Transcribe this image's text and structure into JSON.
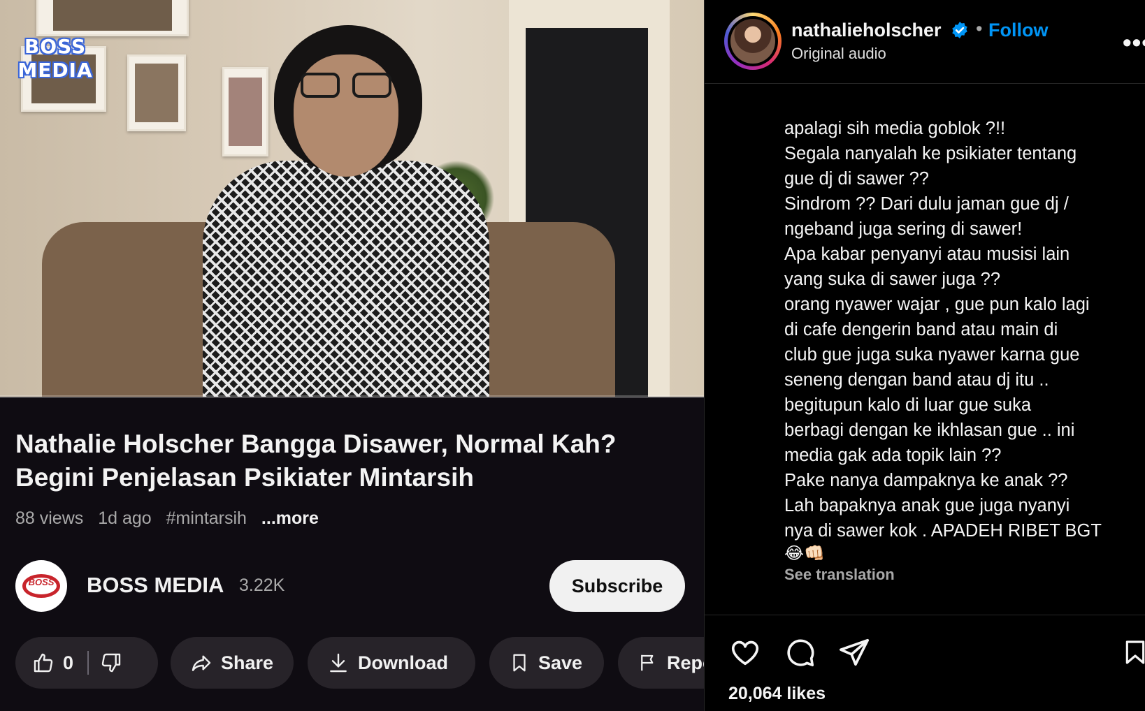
{
  "video": {
    "overlay_logo": [
      "BOSS",
      "MEDIA"
    ],
    "title_line1": "Nathalie Holscher Bangga Disawer, Normal Kah?",
    "title_line2": "Begini Penjelasan Psikiater Mintarsih",
    "views": "88 views",
    "age": "1d ago",
    "hashtag": "#mintarsih",
    "more": "...more",
    "progress_fraction": 0.0,
    "channel": {
      "avatar_text": "BOSS",
      "name": "BOSS MEDIA",
      "subscribers": "3.22K",
      "subscribe_label": "Subscribe"
    },
    "actions": {
      "like_count": "0",
      "share_label": "Share",
      "download_label": "Download",
      "save_label": "Save",
      "report_label": "Report"
    }
  },
  "instagram": {
    "username": "nathalieholscher",
    "verified": true,
    "dot": "•",
    "follow_label": "Follow",
    "audio": "Original audio",
    "more_icon": "more-horizontal-icon",
    "caption_lines": [
      "apalagi sih media goblok ?!!",
      "Segala nanyalah ke psikiater tentang",
      "gue dj di sawer ??",
      "Sindrom ?? Dari dulu jaman gue dj /",
      "ngeband juga sering di sawer!",
      "Apa kabar penyanyi atau musisi lain",
      "yang suka di sawer juga ??",
      "orang nyawer wajar , gue pun kalo lagi",
      "di cafe dengerin band atau main di",
      "club gue juga suka nyawer karna gue",
      "seneng dengan band atau dj itu ..",
      "begitupun kalo di luar gue suka",
      "berbagi dengan ke ikhlasan gue .. ini",
      "media gak ada topik lain ??",
      "Pake nanya dampaknya ke anak ??",
      "Lah bapaknya anak gue juga nyanyi",
      "nya di sawer kok . APADEH RIBET BGT"
    ],
    "caption_emoji": "😂👊🏻",
    "see_translation": "See translation",
    "likes": "20,064 likes",
    "icons": [
      "heart-icon",
      "comment-icon",
      "share-icon",
      "bookmark-icon"
    ],
    "accent_color": "#0095f6"
  }
}
